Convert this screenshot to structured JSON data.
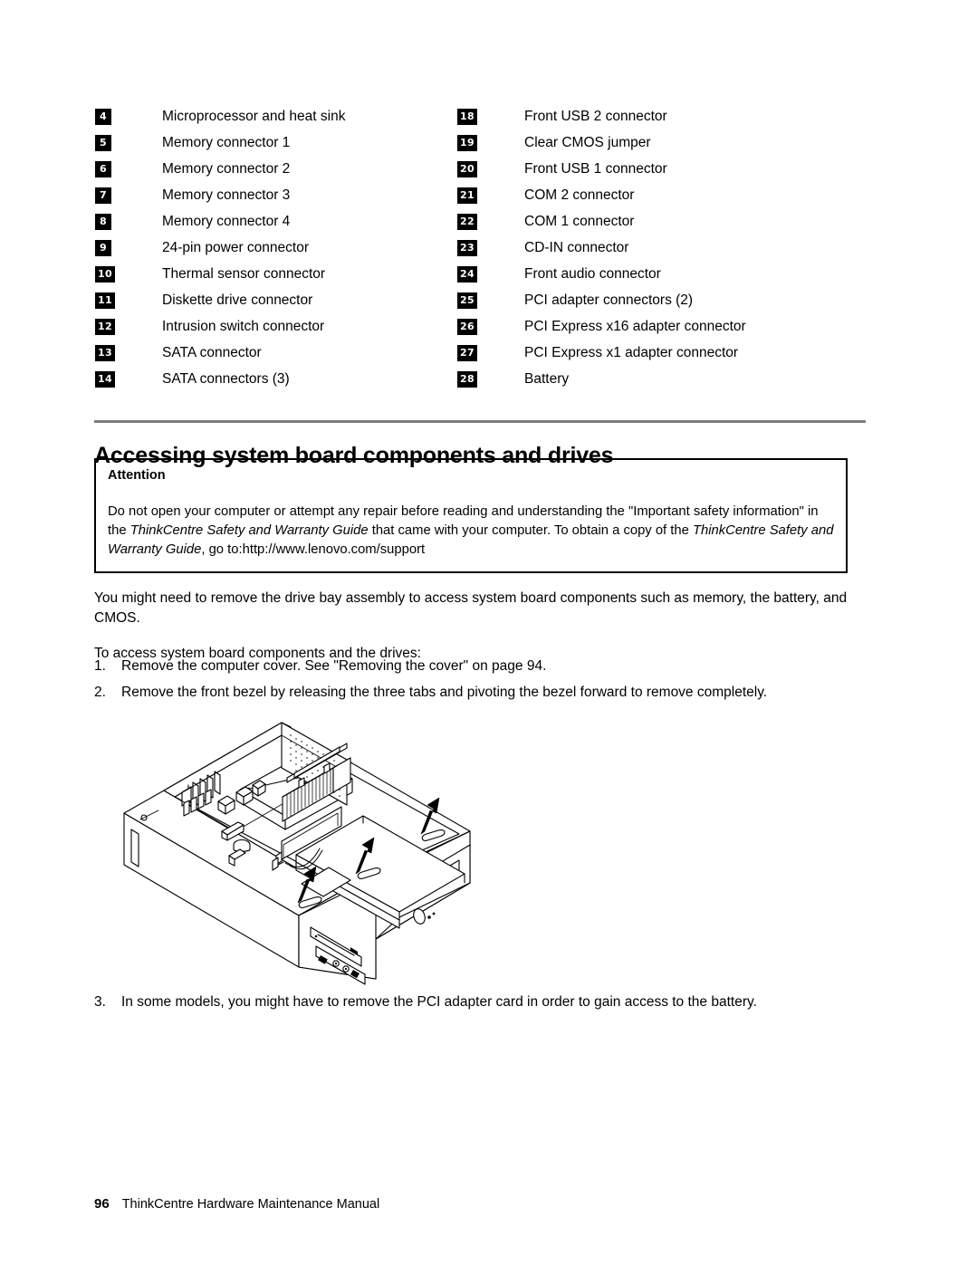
{
  "legend": {
    "left_column": [
      {
        "num": "4",
        "label": "Microprocessor and heat sink"
      },
      {
        "num": "5",
        "label": "Memory connector 1"
      },
      {
        "num": "6",
        "label": "Memory connector 2"
      },
      {
        "num": "7",
        "label": "Memory connector 3"
      },
      {
        "num": "8",
        "label": "Memory connector 4"
      },
      {
        "num": "9",
        "label": "24-pin power connector"
      },
      {
        "num": "10",
        "label": "Thermal sensor connector"
      },
      {
        "num": "11",
        "label": "Diskette drive connector"
      },
      {
        "num": "12",
        "label": "Intrusion switch connector"
      },
      {
        "num": "13",
        "label": "SATA connector"
      },
      {
        "num": "14",
        "label": "SATA connectors (3)"
      }
    ],
    "right_column": [
      {
        "num": "18",
        "label": "Front USB 2 connector"
      },
      {
        "num": "19",
        "label": "Clear CMOS jumper"
      },
      {
        "num": "20",
        "label": "Front USB 1 connector"
      },
      {
        "num": "21",
        "label": "COM 2 connector"
      },
      {
        "num": "22",
        "label": "COM 1 connector"
      },
      {
        "num": "23",
        "label": "CD-IN connector"
      },
      {
        "num": "24",
        "label": "Front audio connector"
      },
      {
        "num": "25",
        "label": "PCI adapter connectors (2)"
      },
      {
        "num": "26",
        "label": "PCI Express x16 adapter connector"
      },
      {
        "num": "27",
        "label": "PCI Express x1 adapter connector"
      },
      {
        "num": "28",
        "label": "Battery"
      }
    ]
  },
  "section": {
    "title": "Accessing system board components and drives"
  },
  "attention": {
    "title": "Attention",
    "line1_a": "Do not open your computer or attempt any repair before reading and understanding the \"Important safety information\"",
    "line2_a": "in the ",
    "line2_i": "ThinkCentre Safety and Warranty Guide",
    "line2_b": " that came with your computer.  To obtain a copy of the ",
    "line2_i2": "ThinkCentre",
    "line3_i": "Safety and Warranty Guide",
    "line3_b": ", go to:http://www.lenovo.com/support"
  },
  "body": {
    "intro": "You might need to remove the drive bay assembly to access system board components such as memory, the battery, and CMOS.",
    "access_lead": "To access system board components and the drives:",
    "steps": [
      {
        "num": "1.",
        "text": "Remove the computer cover. See \"Removing the cover\" on page 94."
      },
      {
        "num": "2.",
        "text": "Remove the front bezel by releasing the three tabs and pivoting the bezel forward to remove completely."
      }
    ],
    "step3": {
      "num": "3.",
      "text": "In some models, you might have to remove the PCI adapter card in order to gain access to the battery."
    }
  },
  "figure": {
    "caption": "Isometric line drawing of an opened ThinkCentre desktop chassis showing the system board, microprocessor heat sink with fan, power supply, drive bay assembly with optical and diskette drives, and three upward arrows indicating lifting the drive bay assembly."
  },
  "footer": {
    "page_number": "96",
    "document_title": "ThinkCentre Hardware Maintenance Manual"
  },
  "colors": {
    "text": "#000000",
    "badge_bg": "#000000",
    "badge_text": "#ffffff",
    "rule": "#7d7d7d",
    "box_border": "#000000",
    "background": "#ffffff"
  }
}
